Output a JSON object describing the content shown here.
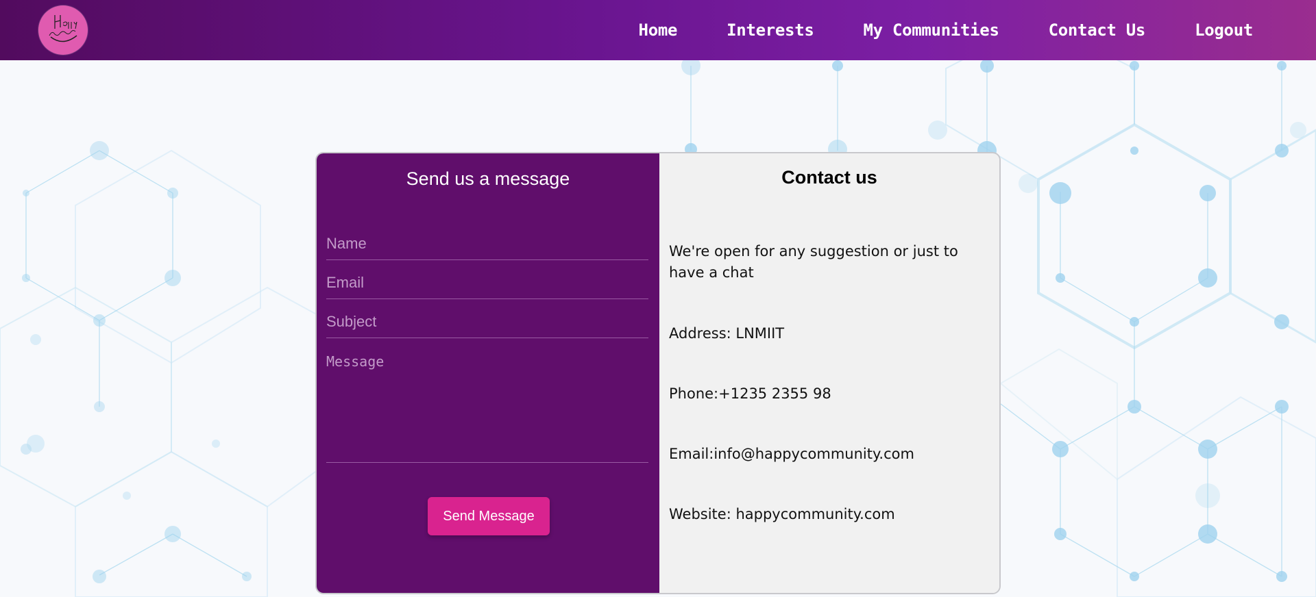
{
  "nav": {
    "logo_alt": "Happy Community",
    "links": [
      "Home",
      "Interests",
      "My Communities",
      "Contact Us",
      "Logout"
    ]
  },
  "form": {
    "title": "Send us a message",
    "name_placeholder": "Name",
    "email_placeholder": "Email",
    "subject_placeholder": "Subject",
    "message_placeholder": "Message",
    "send_label": "Send Message"
  },
  "contact": {
    "title": "Contact us",
    "tagline": "We're open for any suggestion or just to have a chat",
    "address": "Address: LNMIIT",
    "phone": "Phone:+1235 2355 98",
    "email": "Email:info@happycommunity.com",
    "website": "Website: happycommunity.com"
  },
  "colors": {
    "nav_gradient_start": "#520b5e",
    "nav_gradient_end": "#9a2d8f",
    "form_bg": "#600e6b",
    "info_bg": "#f1f1f1",
    "button": "#d9238f",
    "logo": "#e05bb0"
  }
}
